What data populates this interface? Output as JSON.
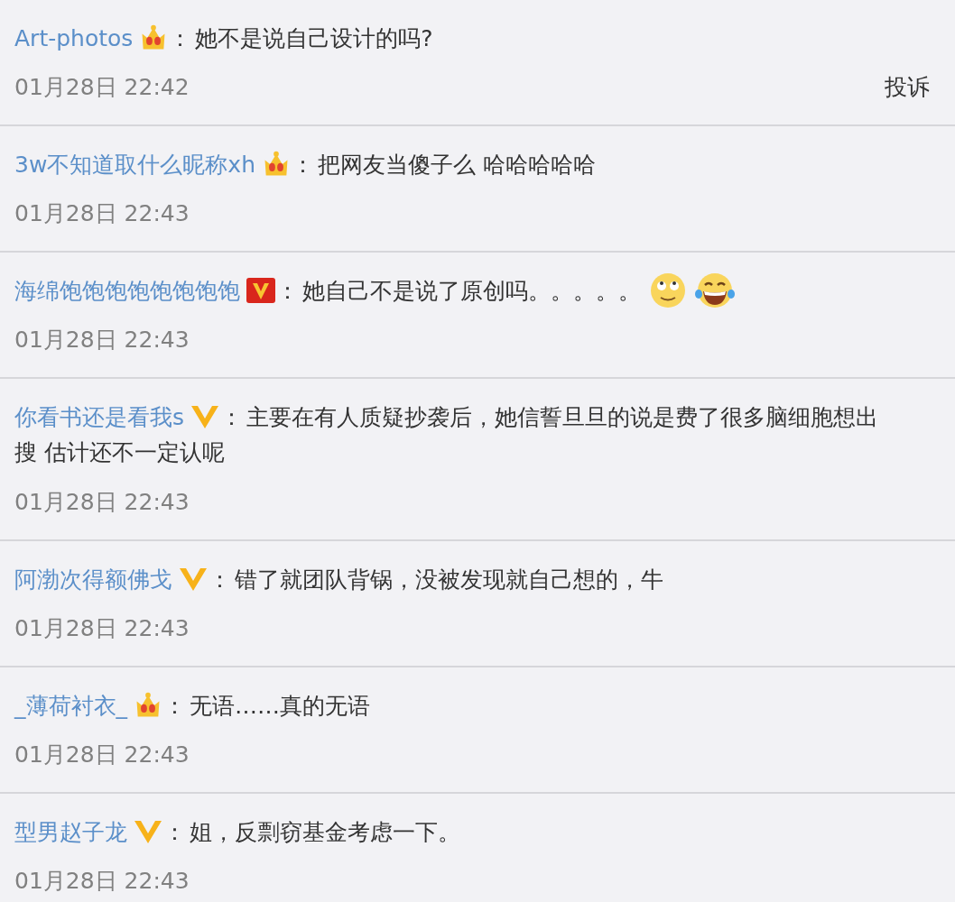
{
  "comments": [
    {
      "user": "Art-photos",
      "badge": {
        "kind": "crown"
      },
      "separator": "：",
      "lines": [
        "她不是说自己设计的吗?"
      ],
      "time": "01月28日 22:42",
      "report": "投诉"
    },
    {
      "user": "3w不知道取什么昵称xh",
      "badge": {
        "kind": "crown"
      },
      "separator": "：",
      "lines": [
        "把网友当傻子么 哈哈哈哈哈"
      ],
      "time": "01月28日 22:43"
    },
    {
      "user": "海绵饱饱饱饱饱饱饱饱",
      "badge": {
        "kind": "red-v"
      },
      "separator": "：",
      "lines": [
        "她自己不是说了原创吗。。。。。"
      ],
      "emojis": [
        {
          "kind": "roll-eyes"
        },
        {
          "kind": "laugh-tears"
        }
      ],
      "time": "01月28日 22:43"
    },
    {
      "user": "你看书还是看我s",
      "badge": {
        "kind": "yellow-v"
      },
      "separator": "：",
      "lines": [
        "主要在有人质疑抄袭后，她信誓旦旦的说是费了很多脑细胞想出",
        "搜 估计还不一定认呢"
      ],
      "time": "01月28日 22:43"
    },
    {
      "user": "阿渤次得额佛戈",
      "badge": {
        "kind": "yellow-v"
      },
      "separator": "：",
      "lines": [
        "错了就团队背锅，没被发现就自己想的，牛"
      ],
      "time": "01月28日 22:43"
    },
    {
      "user": "_薄荷衬衣_",
      "badge": {
        "kind": "crown"
      },
      "separator": "：",
      "lines": [
        "无语……真的无语"
      ],
      "time": "01月28日 22:43"
    },
    {
      "user": "型男赵子龙",
      "badge": {
        "kind": "yellow-v"
      },
      "separator": "：",
      "lines": [
        "姐，反剽窃基金考虑一下。"
      ],
      "time": "01月28日 22:43"
    }
  ]
}
